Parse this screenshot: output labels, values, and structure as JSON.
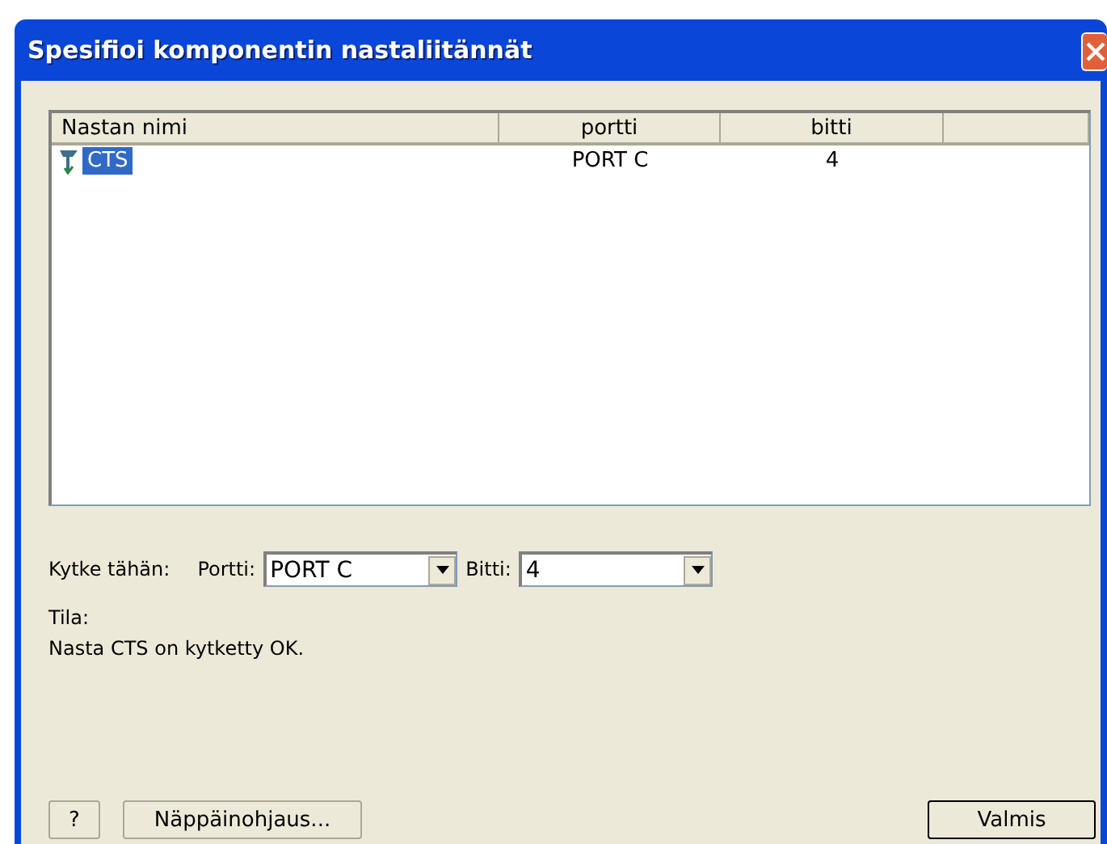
{
  "window": {
    "title": "Spesifioi komponentin nastaliitännät"
  },
  "table": {
    "columns": [
      "Nastan nimi",
      "portti",
      "bitti"
    ],
    "rows": [
      {
        "name": "CTS",
        "port": "PORT C",
        "bit": "4",
        "selected": true
      }
    ]
  },
  "connect": {
    "label": "Kytke tähän:",
    "port_label": "Portti:",
    "port_value": "PORT C",
    "bit_label": "Bitti:",
    "bit_value": "4"
  },
  "status": {
    "label": "Tila:",
    "message": "Nasta CTS on kytketty OK."
  },
  "buttons": {
    "help": "?",
    "keyboard": "Näppäinohjaus...",
    "done": "Valmis"
  }
}
